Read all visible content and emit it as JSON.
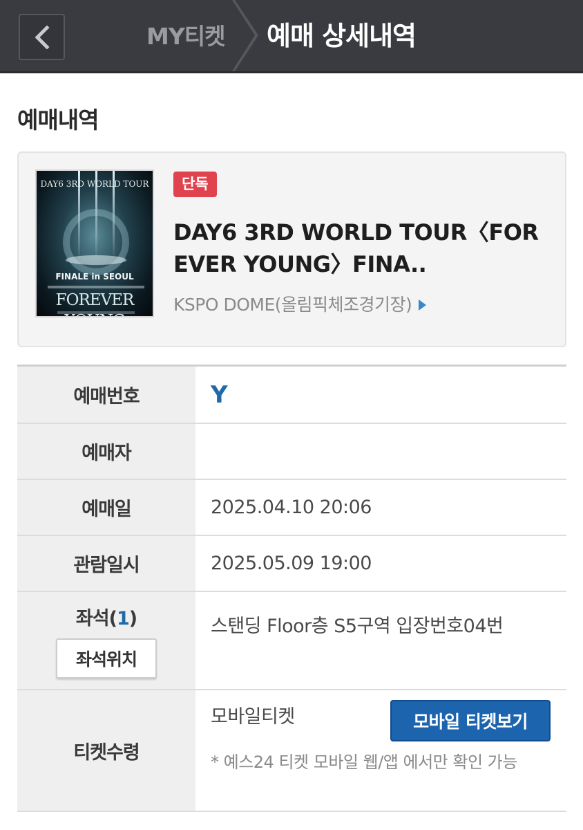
{
  "header": {
    "parent_label": "MY티켓",
    "current_label": "예매 상세내역",
    "back_icon": "chevron-left-icon"
  },
  "section_title": "예매내역",
  "event": {
    "badge": "단독",
    "title": "DAY6 3RD WORLD TOUR〈FOREVER YOUNG〉FINA..",
    "venue": "KSPO DOME(올림픽체조경기장)",
    "poster": {
      "top_text": "DAY6 3RD WORLD TOUR",
      "finale_text": "FINALE in SEOUL",
      "main_text": "FOREVER YOUNG"
    }
  },
  "details": {
    "booking_no_label": "예매번호",
    "booking_no": "Y",
    "booker_label": "예매자",
    "booker": "",
    "booking_date_label": "예매일",
    "booking_date": "2025.04.10 20:06",
    "show_date_label": "관람일시",
    "show_date": "2025.05.09 19:00",
    "seat_label": "좌석(",
    "seat_count": "1",
    "seat_label_end": ")",
    "seat_position_button": "좌석위치",
    "seat_value": "스탠딩 Floor층 S5구역 입장번호04번",
    "ticket_label": "티켓수령",
    "ticket_method": "모바일티켓",
    "mobile_ticket_button": "모바일 티켓보기",
    "ticket_note": "* 예스24 티켓 모바일 웹/앱 에서만 확인 가능"
  },
  "colors": {
    "header_bg": "#3a3b40",
    "badge_red": "#e0434e",
    "accent_blue": "#1d64ae",
    "link_blue": "#1f6aa8"
  }
}
